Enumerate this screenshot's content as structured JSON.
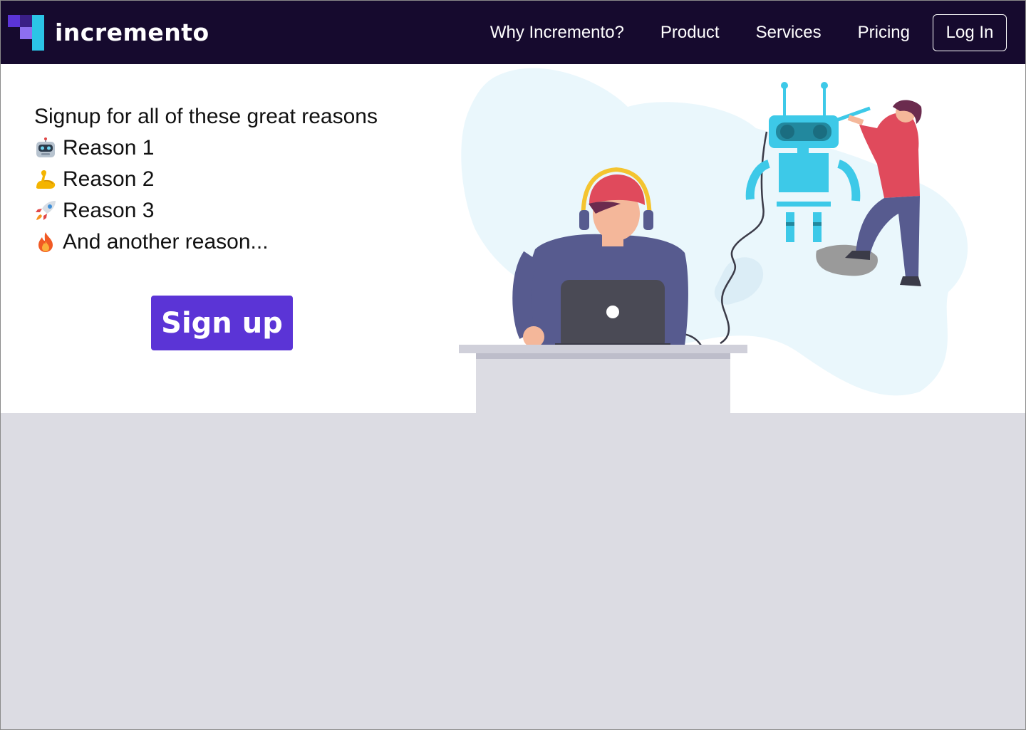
{
  "brand": {
    "name": "incremento",
    "logo_colors": [
      "#5b34d6",
      "#8d6ff0",
      "#2bc4e6",
      "#b6a3f7"
    ]
  },
  "nav": {
    "links": [
      {
        "label": "Why Incremento?"
      },
      {
        "label": "Product"
      },
      {
        "label": "Services"
      },
      {
        "label": "Pricing"
      }
    ],
    "login_label": "Log In"
  },
  "hero": {
    "headline": "Signup for all of these great reasons",
    "reasons": [
      {
        "icon": "robot-icon",
        "label": "Reason 1"
      },
      {
        "icon": "flexed-biceps-icon",
        "label": "Reason 2"
      },
      {
        "icon": "rocket-icon",
        "label": "Reason 3"
      },
      {
        "icon": "fire-icon",
        "label": "And another reason..."
      }
    ],
    "signup_label": "Sign up",
    "illustration": "person-at-laptop-building-robot-illustration"
  },
  "colors": {
    "navbar_bg": "#160a2e",
    "accent": "#5b34d6",
    "hero_bg": "#ffffff",
    "page_bg": "#dcdce3"
  }
}
